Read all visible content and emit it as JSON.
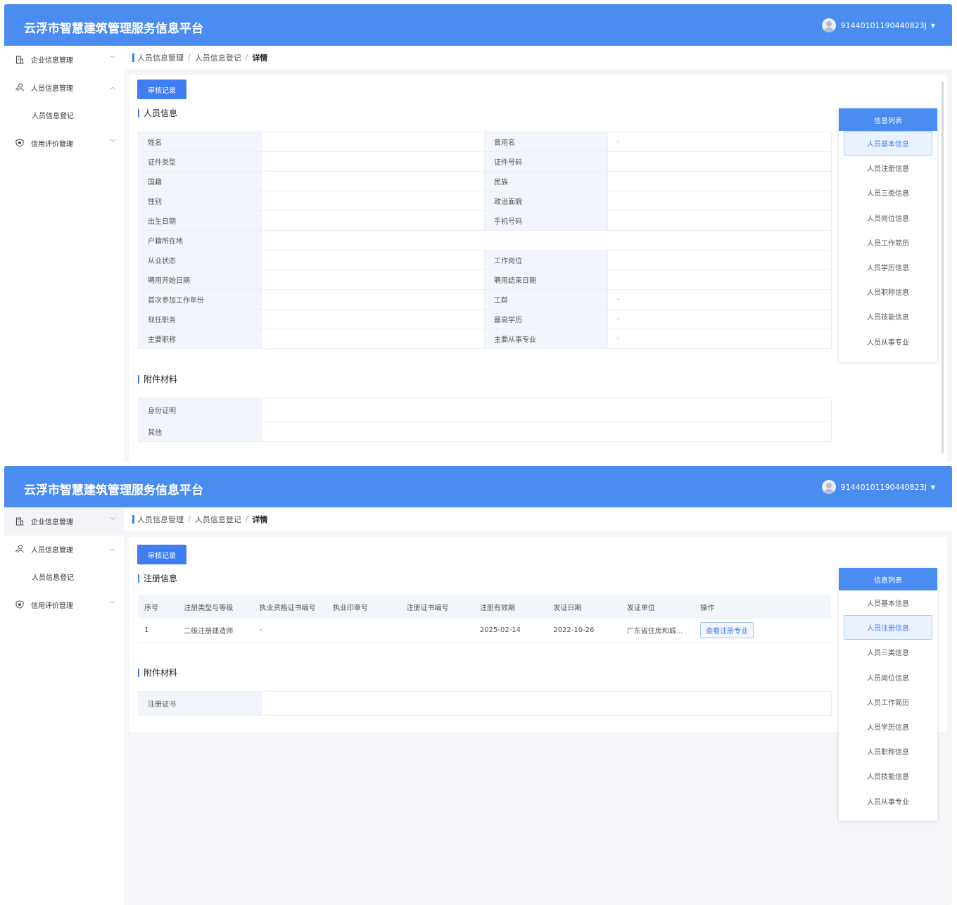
{
  "app": {
    "title": "云浮市智慧建筑管理服务信息平台",
    "user": "91440101190440823J"
  },
  "sidebar": {
    "items": [
      {
        "label": "企业信息管理"
      },
      {
        "label": "人员信息管理"
      },
      {
        "label": "人员信息登记"
      },
      {
        "label": "信用评价管理"
      }
    ]
  },
  "breadcrumb": [
    "人员信息管理",
    "人员信息登记",
    "详情"
  ],
  "audit_button": "审核记录",
  "info_list": {
    "title": "信息列表",
    "items": [
      "人员基本信息",
      "人员注册信息",
      "人员三类信息",
      "人员岗位信息",
      "人员工作简历",
      "人员学历信息",
      "人员职称信息",
      "人员技能信息",
      "人员从事专业"
    ]
  },
  "personal": {
    "section_title": "人员信息",
    "rows": [
      {
        "l1": "姓名",
        "v1": "",
        "l2": "曾用名",
        "v2": "-"
      },
      {
        "l1": "证件类型",
        "v1": "",
        "l2": "证件号码",
        "v2": ""
      },
      {
        "l1": "国籍",
        "v1": "",
        "l2": "民族",
        "v2": ""
      },
      {
        "l1": "性别",
        "v1": "",
        "l2": "政治面貌",
        "v2": ""
      },
      {
        "l1": "出生日期",
        "v1": "",
        "l2": "手机号码",
        "v2": ""
      },
      {
        "l1": "户籍所在地",
        "v1": ""
      },
      {
        "l1": "从业状态",
        "v1": "",
        "l2": "工作岗位",
        "v2": ""
      },
      {
        "l1": "聘用开始日期",
        "v1": "",
        "l2": "聘用结束日期",
        "v2": ""
      },
      {
        "l1": "首次参加工作年份",
        "v1": "",
        "l2": "工龄",
        "v2": "-"
      },
      {
        "l1": "现任职务",
        "v1": "",
        "l2": "最高学历",
        "v2": "-"
      },
      {
        "l1": "主要职称",
        "v1": "",
        "l2": "主要从事专业",
        "v2": "-"
      }
    ],
    "attachments_title": "附件材料",
    "attachments": [
      "身份证明",
      "其他"
    ]
  },
  "registration": {
    "section_title": "注册信息",
    "columns": [
      "序号",
      "注册类型与等级",
      "执业资格证书编号",
      "执业印章号",
      "注册证书编号",
      "注册有效期",
      "发证日期",
      "发证单位",
      "操作"
    ],
    "rows": [
      {
        "no": "1",
        "type": "二级注册建造师",
        "cert_no": "-",
        "seal_no": "",
        "reg_cert_no": "",
        "valid": "2025-02-14",
        "issue_date": "2022-10-26",
        "issuer": "广东省住房和城...",
        "action": "查看注册专业"
      }
    ],
    "attachments_title": "附件材料",
    "attachments": [
      "注册证书"
    ]
  },
  "colors": {
    "header": "#4a8cf0",
    "primary": "#3f7ef0",
    "label_bg": "#f2f5fb"
  }
}
